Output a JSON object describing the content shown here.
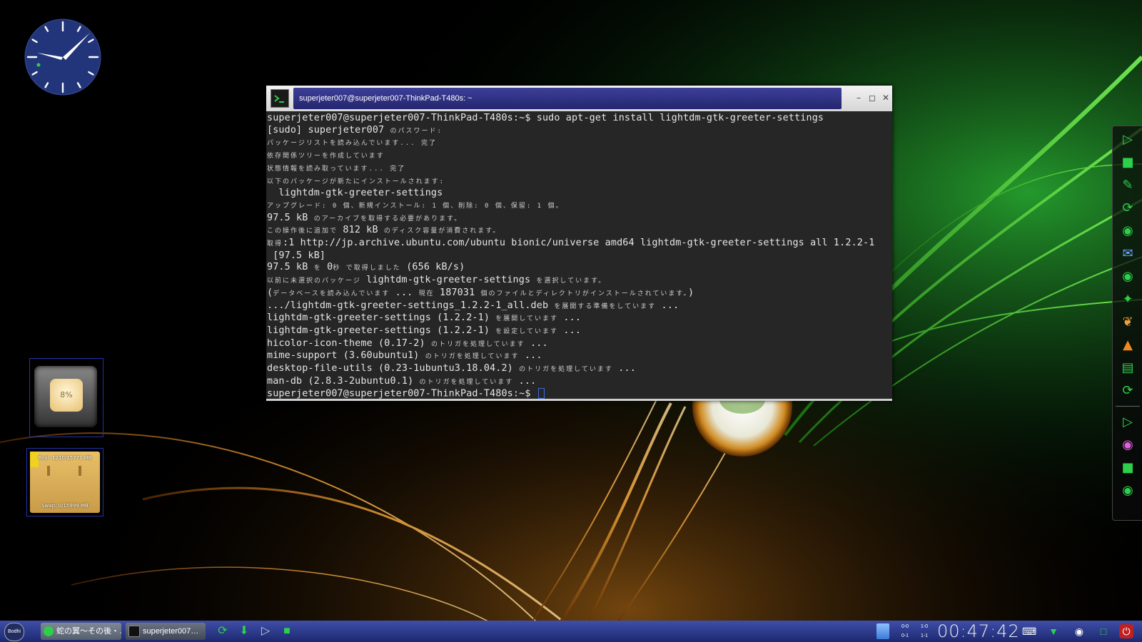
{
  "terminal": {
    "window_title": "superjeter007@superjeter007-ThinkPad-T480s: ~",
    "lines": [
      {
        "t": "superjeter007@superjeter007-ThinkPad-T480s:~$ sudo apt-get install lightdm-gtk-greeter-settings"
      },
      {
        "t": "[sudo] superjeter007 ",
        "jp": "のパスワード:"
      },
      {
        "jp": "パッケージリストを読み込んでいます... 完了"
      },
      {
        "jp": "依存関係ツリーを作成しています"
      },
      {
        "jp": "状態情報を読み取っています... 完了"
      },
      {
        "jp": "以下のパッケージが新たにインストールされます:"
      },
      {
        "t": "  lightdm-gtk-greeter-settings"
      },
      {
        "jp": "アップグレード: 0 個、新規インストール: 1 個、削除: 0 個、保留: 1 個。"
      },
      {
        "t": "97.5 kB ",
        "jp": "のアーカイブを取得する必要があります。"
      },
      {
        "jp": "この操作後に追加で ",
        "t2": "812 kB ",
        "jp2": "のディスク容量が消費されます。"
      },
      {
        "jp": "取得",
        "t2": ":1 http://jp.archive.ubuntu.com/ubuntu bionic/universe amd64 lightdm-gtk-greeter-settings all 1.2.2-1"
      },
      {
        "t": " [97.5 kB]"
      },
      {
        "t": "97.5 kB ",
        "jp": "を ",
        "t2": "0",
        "jp2": "秒 で取得しました ",
        "t3": "(656 kB/s)"
      },
      {
        "jp": "以前に未選択のパッケージ ",
        "t2": "lightdm-gtk-greeter-settings ",
        "jp2": "を選択しています。"
      },
      {
        "t": "(",
        "jp": "データベースを読み込んでいます ",
        "t2": "... ",
        "jp2": "現在 ",
        "t3": "187031 ",
        "jp3": "個のファイルとディレクトリがインストールされています。",
        "t4": ")"
      },
      {
        "t": ".../lightdm-gtk-greeter-settings_1.2.2-1_all.deb ",
        "jp": "を展開する準備をしています ",
        "t2": "..."
      },
      {
        "t": "lightdm-gtk-greeter-settings (1.2.2-1) ",
        "jp": "を展開しています ",
        "t2": "..."
      },
      {
        "t": "lightdm-gtk-greeter-settings (1.2.2-1) ",
        "jp": "を設定しています ",
        "t2": "..."
      },
      {
        "t": "hicolor-icon-theme (0.17-2) ",
        "jp": "のトリガを処理しています ",
        "t2": "..."
      },
      {
        "t": "mime-support (3.60ubuntu1) ",
        "jp": "のトリガを処理しています ",
        "t2": "..."
      },
      {
        "t": "desktop-file-utils (0.23-1ubuntu3.18.04.2) ",
        "jp": "のトリガを処理しています ",
        "t2": "..."
      },
      {
        "t": "man-db (2.8.3-2ubuntu0.1) ",
        "jp": "のトリガを処理しています ",
        "t2": "..."
      },
      {
        "t": "superjeter007@superjeter007-ThinkPad-T480s:~$ ",
        "cursor": true
      }
    ]
  },
  "widgets": {
    "cpu_percent": "8%",
    "mem_real": "Real: 1210/15771 MB",
    "mem_swap": "Swap: 0/15999 MB"
  },
  "taskbar": {
    "menu_label": "Bodhi",
    "tasks": [
      {
        "label": "蛇の翼〜その後・…"
      },
      {
        "label": "superjeter007…"
      }
    ],
    "pager": [
      {
        "top": "0-0",
        "bottom": "0-1"
      },
      {
        "top": "1-0",
        "bottom": "1-1"
      }
    ],
    "clock": "00:47:42"
  },
  "colors": {
    "taskbar": "#2a3788",
    "accent_green": "#2dd04a",
    "terminal_bg": "#262626",
    "title_tab": "#2f3186"
  },
  "dock_icons": [
    "terminal-icon",
    "folder-icon",
    "text-editor-icon",
    "refresh-icon",
    "firefox-icon",
    "thunderbird-icon",
    "camera-icon",
    "gimp-icon",
    "bird-icon",
    "vlc-icon",
    "document-icon",
    "spiral-icon",
    "terminal-icon",
    "eye-icon",
    "folder-icon",
    "firefox-icon"
  ]
}
